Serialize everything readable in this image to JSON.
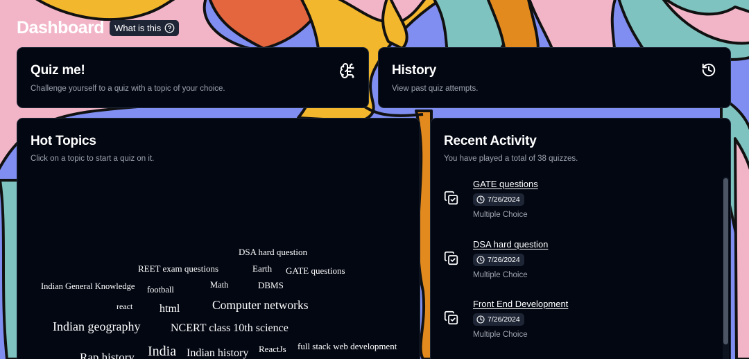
{
  "header": {
    "title": "Dashboard",
    "help_label": "What is this",
    "help_icon": "help-circle-icon"
  },
  "quiz_card": {
    "title": "Quiz me!",
    "subtitle": "Challenge yourself to a quiz with a topic of your choice.",
    "icon": "brain-circuit-icon"
  },
  "history_card": {
    "title": "History",
    "subtitle": "View past quiz attempts.",
    "icon": "history-icon"
  },
  "hot_topics": {
    "title": "Hot Topics",
    "subtitle": "Click on a topic to start a quiz on it.",
    "topics": [
      "DSA hard question",
      "REET exam questions",
      "Earth",
      "GATE questions",
      "Indian General Knowledge",
      "football",
      "Math",
      "DBMS",
      "react",
      "html",
      "Computer networks",
      "Indian geography",
      "NCERT class 10th science",
      "Rap history",
      "India",
      "Indian history",
      "ReactJs",
      "full stack web development"
    ]
  },
  "recent_activity": {
    "title": "Recent Activity",
    "subtitle": "You have played a total of 38 quizzes.",
    "items": [
      {
        "topic": "GATE questions",
        "date": "7/26/2024",
        "type": "Multiple Choice",
        "icon": "copy-check-icon"
      },
      {
        "topic": "DSA hard question",
        "date": "7/26/2024",
        "type": "Multiple Choice",
        "icon": "copy-check-icon"
      },
      {
        "topic": "Front End Development",
        "date": "7/26/2024",
        "type": "Multiple Choice",
        "icon": "copy-check-icon"
      }
    ]
  },
  "colors": {
    "card_bg": "#030712",
    "muted_text": "#9ca3af",
    "badge_bg": "#1e2535"
  }
}
